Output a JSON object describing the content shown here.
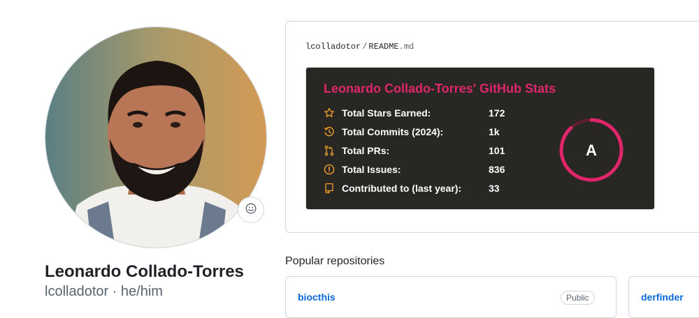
{
  "profile": {
    "full_name": "Leonardo Collado-Torres",
    "username": "lcolladotor",
    "pronouns_line": "lcolladotor · he/him",
    "avatar_icon": "profile-photo",
    "status_icon": "smiley-icon"
  },
  "readme": {
    "owner": "lcolladotor",
    "separator": "/",
    "file_base": "README",
    "file_ext": ".md"
  },
  "stats_card": {
    "title": "Leonardo Collado-Torres' GitHub Stats",
    "accent_color": "#e0266b",
    "icon_color": "#f0a12c",
    "background": "#282723",
    "rows": [
      {
        "label": "Total Stars Earned:",
        "value": "172",
        "icon": "star-icon"
      },
      {
        "label": "Total Commits (2024):",
        "value": "1k",
        "icon": "history-icon"
      },
      {
        "label": "Total PRs:",
        "value": "101",
        "icon": "pull-request-icon"
      },
      {
        "label": "Total Issues:",
        "value": "836",
        "icon": "issue-icon"
      },
      {
        "label": "Contributed to (last year):",
        "value": "33",
        "icon": "repo-icon"
      }
    ],
    "rank": "A",
    "rank_progress": 0.88
  },
  "popular": {
    "heading": "Popular repositories",
    "repos": [
      {
        "name": "biocthis",
        "visibility": "Public"
      },
      {
        "name": "derfinder",
        "visibility": ""
      }
    ]
  }
}
